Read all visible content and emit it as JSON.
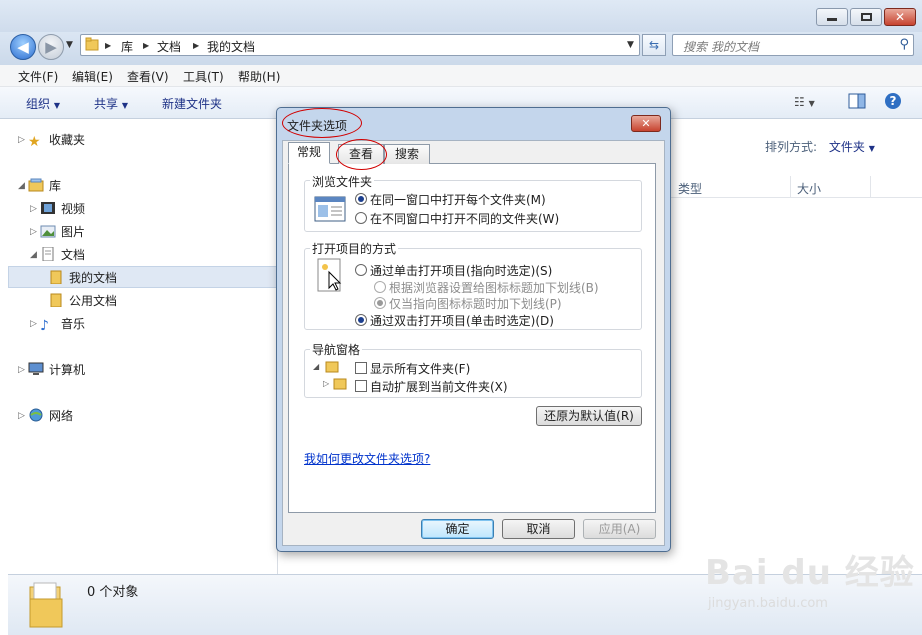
{
  "explorer": {
    "address": [
      "库",
      "文档",
      "我的文档"
    ],
    "search_placeholder": "搜索 我的文档",
    "menu": [
      "文件(F)",
      "编辑(E)",
      "查看(V)",
      "工具(T)",
      "帮助(H)"
    ],
    "toolbar": {
      "organize": "组织",
      "share": "共享",
      "new_folder": "新建文件夹"
    },
    "nav": {
      "favorites": "收藏夹",
      "libraries": "库",
      "videos": "视频",
      "pictures": "图片",
      "documents": "文档",
      "my_documents": "我的文档",
      "public_documents": "公用文档",
      "music": "音乐",
      "computer": "计算机",
      "network": "网络"
    },
    "arrange_label": "排列方式:",
    "arrange_value": "文件夹",
    "columns": {
      "type": "类型",
      "size": "大小"
    },
    "status": "0 个对象"
  },
  "dialog": {
    "title": "文件夹选项",
    "tabs": [
      "常规",
      "查看",
      "搜索"
    ],
    "browse_group": "浏览文件夹",
    "browse_same": "在同一窗口中打开每个文件夹(M)",
    "browse_new": "在不同窗口中打开不同的文件夹(W)",
    "click_group": "打开项目的方式",
    "single_click": "通过单击打开项目(指向时选定)(S)",
    "underline_browser": "根据浏览器设置给图标标题加下划线(B)",
    "underline_point": "仅当指向图标标题时加下划线(P)",
    "double_click": "通过双击打开项目(单击时选定)(D)",
    "nav_group": "导航窗格",
    "show_all": "显示所有文件夹(F)",
    "auto_expand": "自动扩展到当前文件夹(X)",
    "restore": "还原为默认值(R)",
    "help_link": "我如何更改文件夹选项?",
    "ok": "确定",
    "cancel": "取消",
    "apply": "应用(A)"
  },
  "watermark": {
    "brand": "Bai du 经验",
    "url": "jingyan.baidu.com"
  },
  "colors": {
    "annotation": "#d10000",
    "link": "#0033cc",
    "selection": "#dfe8f4"
  }
}
